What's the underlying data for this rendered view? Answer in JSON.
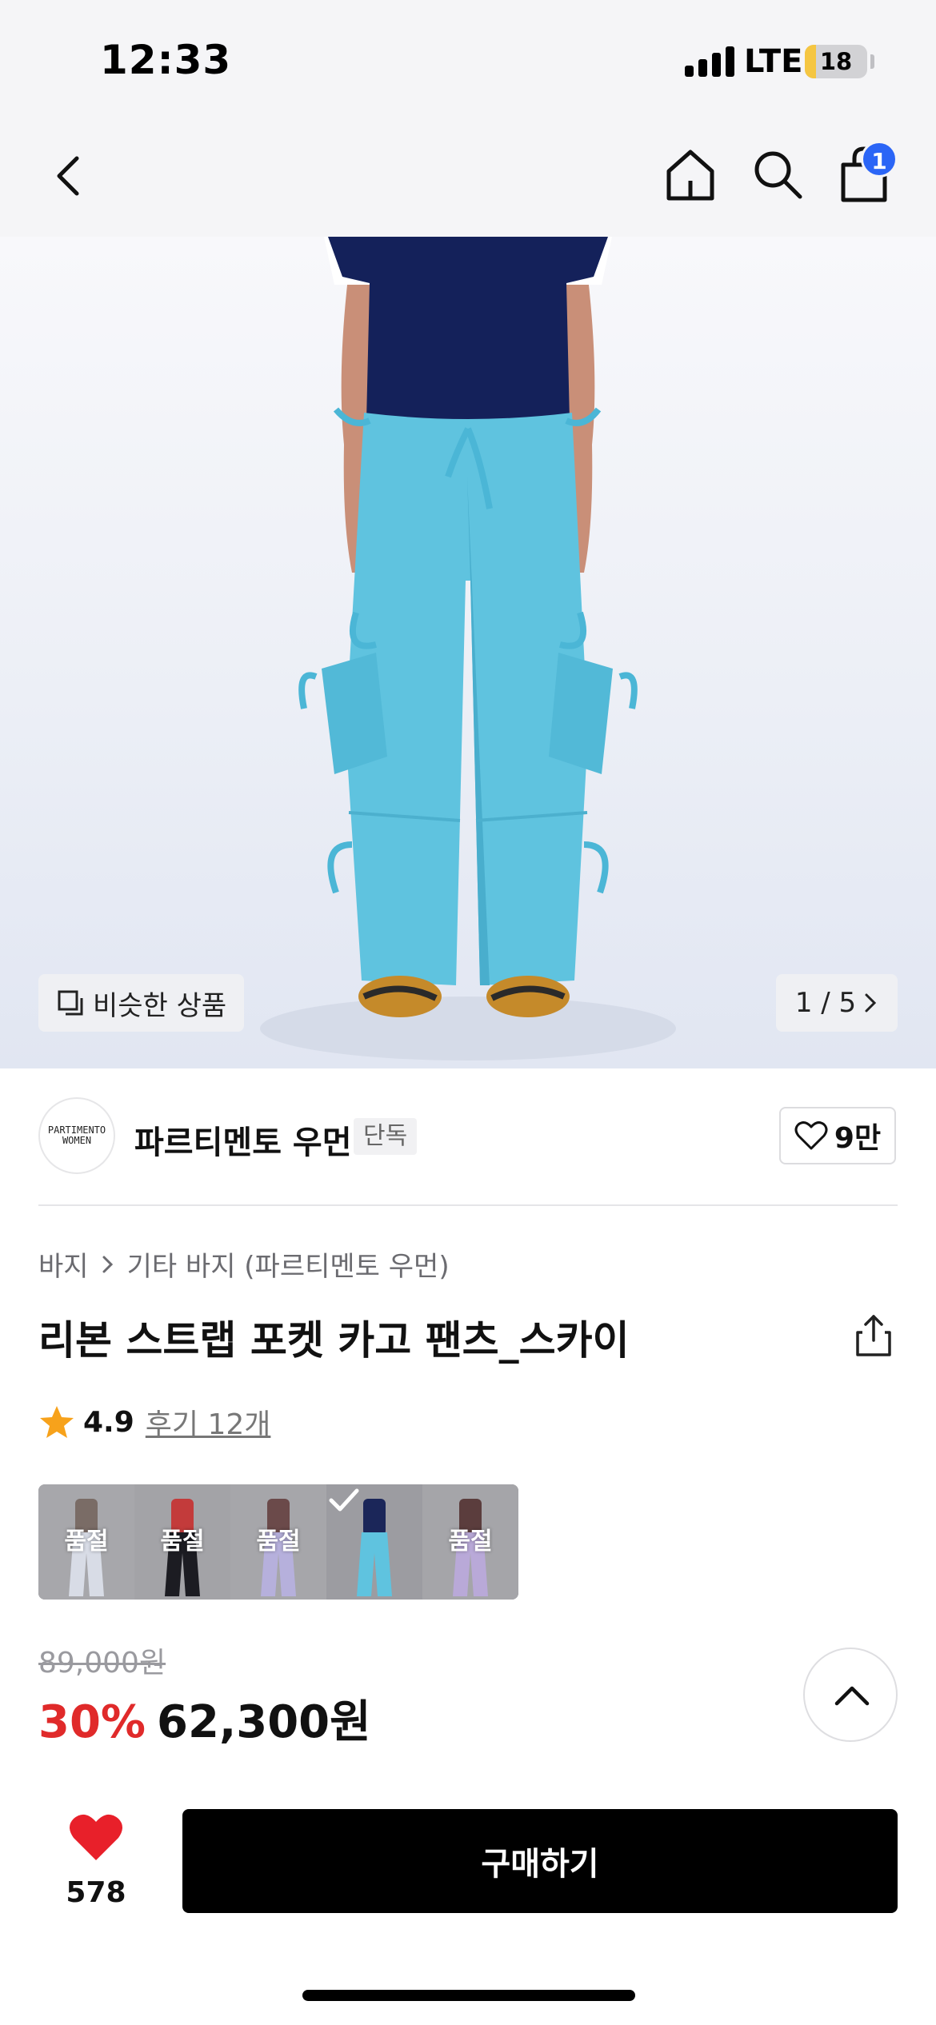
{
  "status_bar": {
    "time": "12:33",
    "network": "LTE",
    "battery_level": "18",
    "battery_fraction": 0.18,
    "signal_bars": 4
  },
  "nav": {
    "icons": [
      "back-icon",
      "home-icon",
      "search-icon",
      "shopping-bag-icon"
    ],
    "cart_count": "1"
  },
  "gallery": {
    "similar_label": "비슷한 상품",
    "page_indicator": "1 / 5",
    "current_image": 1,
    "total_images": 5
  },
  "brand": {
    "logo_line1": "PARTIMENTO",
    "logo_line2": "WOMEN",
    "name": "파르티멘토 우먼",
    "tag": "단독",
    "like_count": "9만"
  },
  "product": {
    "breadcrumb_root": "바지",
    "breadcrumb_leaf": "기타 바지 (파르티멘토 우먼)",
    "title": "리본 스트랩 포켓 카고 팬츠_스카이",
    "rating": "4.9",
    "review_label": "후기 12개"
  },
  "variants": [
    {
      "label": "품절",
      "color": "#d8dce6",
      "sold_out": true
    },
    {
      "label": "품절",
      "color": "#1c1c22",
      "sold_out": true
    },
    {
      "label": "품절",
      "color": "#b6b0dc",
      "sold_out": true
    },
    {
      "label": "",
      "color": "#5fc3df",
      "sold_out": false,
      "selected": true
    },
    {
      "label": "품절",
      "color": "#b9a9d8",
      "sold_out": true
    }
  ],
  "price": {
    "original": "89,000원",
    "discount": "30%",
    "sale": "62,300원"
  },
  "bottom_bar": {
    "like_count": "578",
    "buy_label": "구매하기"
  },
  "colors": {
    "accent_blue": "#2b65f6",
    "discount_red": "#e02a2a",
    "heart_red": "#e8202a",
    "star_orange": "#f7a21b",
    "pants_sky": "#5fc3df"
  }
}
